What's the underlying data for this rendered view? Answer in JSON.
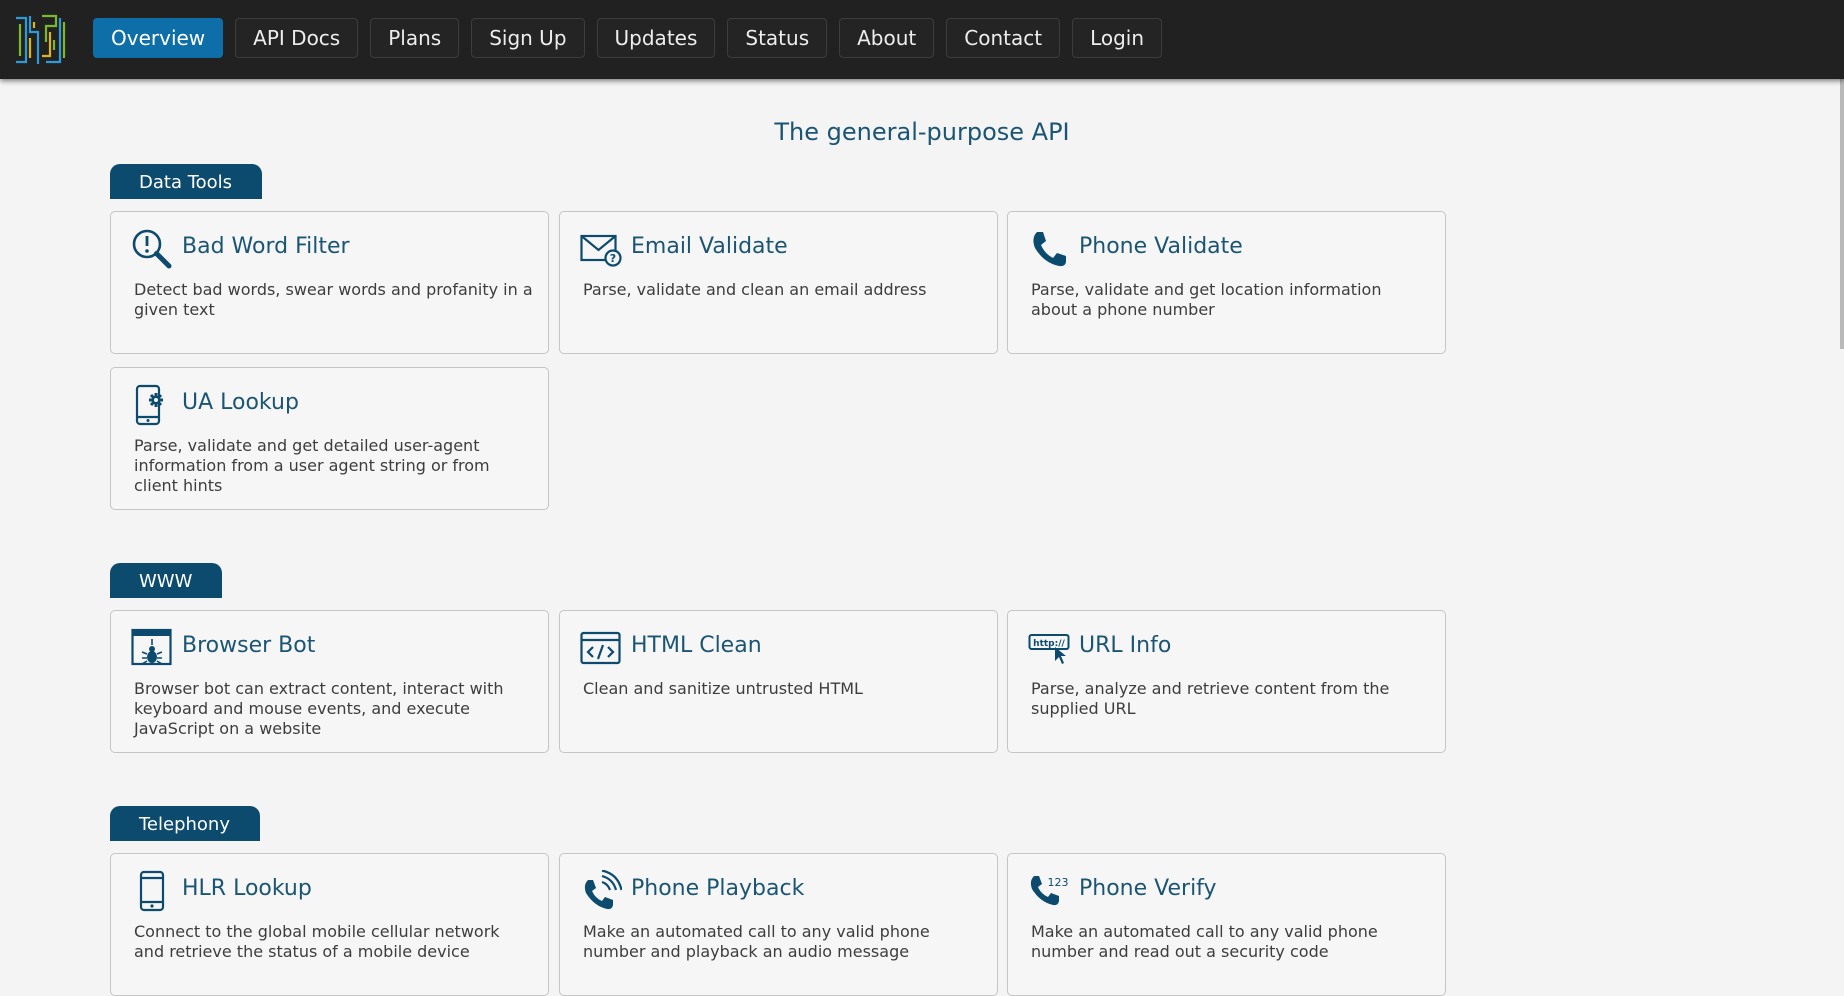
{
  "nav": {
    "items": [
      {
        "label": "Overview",
        "active": true
      },
      {
        "label": "API Docs",
        "active": false
      },
      {
        "label": "Plans",
        "active": false
      },
      {
        "label": "Sign Up",
        "active": false
      },
      {
        "label": "Updates",
        "active": false
      },
      {
        "label": "Status",
        "active": false
      },
      {
        "label": "About",
        "active": false
      },
      {
        "label": "Contact",
        "active": false
      },
      {
        "label": "Login",
        "active": false
      }
    ]
  },
  "main": {
    "headline": "The general-purpose API",
    "sections": [
      {
        "label": "Data Tools",
        "cards": [
          {
            "icon": "magnifier-alert-icon",
            "title": "Bad Word Filter",
            "description": "Detect bad words, swear words and profanity in a given text"
          },
          {
            "icon": "envelope-question-icon",
            "title": "Email Validate",
            "description": "Parse, validate and clean an email address"
          },
          {
            "icon": "phone-handset-icon",
            "title": "Phone Validate",
            "description": "Parse, validate and get location information about a phone number"
          },
          {
            "icon": "mobile-gear-icon",
            "title": "UA Lookup",
            "description": "Parse, validate and get detailed user-agent information from a user agent string or from client hints"
          }
        ]
      },
      {
        "label": "WWW",
        "cards": [
          {
            "icon": "browser-bug-icon",
            "title": "Browser Bot",
            "description": "Browser bot can extract content, interact with keyboard and mouse events, and execute JavaScript on a website"
          },
          {
            "icon": "code-window-icon",
            "title": "HTML Clean",
            "description": "Clean and sanitize untrusted HTML"
          },
          {
            "icon": "http-cursor-icon",
            "title": "URL Info",
            "description": "Parse, analyze and retrieve content from the supplied URL"
          }
        ]
      },
      {
        "label": "Telephony",
        "cards": [
          {
            "icon": "mobile-phone-icon",
            "title": "HLR Lookup",
            "description": "Connect to the global mobile cellular network and retrieve the status of a mobile device"
          },
          {
            "icon": "phone-sound-icon",
            "title": "Phone Playback",
            "description": "Make an automated call to any valid phone number and playback an audio message"
          },
          {
            "icon": "phone-123-icon",
            "title": "Phone Verify",
            "description": "Make an automated call to any valid phone number and read out a security code"
          }
        ]
      }
    ]
  },
  "icon_glyphs": {
    "phone_verify_digits": "123",
    "url_info_text": "http://"
  },
  "colors": {
    "topbar": "#212121",
    "active_nav": "#0e6ea8",
    "section_label": "#0c4a6e",
    "title_text": "#1b5574",
    "background": "#f4f4f4"
  }
}
